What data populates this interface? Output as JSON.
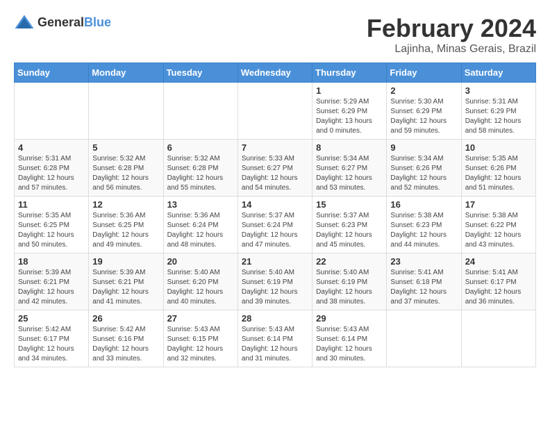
{
  "logo": {
    "general": "General",
    "blue": "Blue"
  },
  "title": {
    "month": "February 2024",
    "location": "Lajinha, Minas Gerais, Brazil"
  },
  "headers": [
    "Sunday",
    "Monday",
    "Tuesday",
    "Wednesday",
    "Thursday",
    "Friday",
    "Saturday"
  ],
  "weeks": [
    [
      {
        "day": "",
        "info": ""
      },
      {
        "day": "",
        "info": ""
      },
      {
        "day": "",
        "info": ""
      },
      {
        "day": "",
        "info": ""
      },
      {
        "day": "1",
        "sunrise": "Sunrise: 5:29 AM",
        "sunset": "Sunset: 6:29 PM",
        "daylight": "Daylight: 13 hours and 0 minutes."
      },
      {
        "day": "2",
        "sunrise": "Sunrise: 5:30 AM",
        "sunset": "Sunset: 6:29 PM",
        "daylight": "Daylight: 12 hours and 59 minutes."
      },
      {
        "day": "3",
        "sunrise": "Sunrise: 5:31 AM",
        "sunset": "Sunset: 6:29 PM",
        "daylight": "Daylight: 12 hours and 58 minutes."
      }
    ],
    [
      {
        "day": "4",
        "sunrise": "Sunrise: 5:31 AM",
        "sunset": "Sunset: 6:28 PM",
        "daylight": "Daylight: 12 hours and 57 minutes."
      },
      {
        "day": "5",
        "sunrise": "Sunrise: 5:32 AM",
        "sunset": "Sunset: 6:28 PM",
        "daylight": "Daylight: 12 hours and 56 minutes."
      },
      {
        "day": "6",
        "sunrise": "Sunrise: 5:32 AM",
        "sunset": "Sunset: 6:28 PM",
        "daylight": "Daylight: 12 hours and 55 minutes."
      },
      {
        "day": "7",
        "sunrise": "Sunrise: 5:33 AM",
        "sunset": "Sunset: 6:27 PM",
        "daylight": "Daylight: 12 hours and 54 minutes."
      },
      {
        "day": "8",
        "sunrise": "Sunrise: 5:34 AM",
        "sunset": "Sunset: 6:27 PM",
        "daylight": "Daylight: 12 hours and 53 minutes."
      },
      {
        "day": "9",
        "sunrise": "Sunrise: 5:34 AM",
        "sunset": "Sunset: 6:26 PM",
        "daylight": "Daylight: 12 hours and 52 minutes."
      },
      {
        "day": "10",
        "sunrise": "Sunrise: 5:35 AM",
        "sunset": "Sunset: 6:26 PM",
        "daylight": "Daylight: 12 hours and 51 minutes."
      }
    ],
    [
      {
        "day": "11",
        "sunrise": "Sunrise: 5:35 AM",
        "sunset": "Sunset: 6:25 PM",
        "daylight": "Daylight: 12 hours and 50 minutes."
      },
      {
        "day": "12",
        "sunrise": "Sunrise: 5:36 AM",
        "sunset": "Sunset: 6:25 PM",
        "daylight": "Daylight: 12 hours and 49 minutes."
      },
      {
        "day": "13",
        "sunrise": "Sunrise: 5:36 AM",
        "sunset": "Sunset: 6:24 PM",
        "daylight": "Daylight: 12 hours and 48 minutes."
      },
      {
        "day": "14",
        "sunrise": "Sunrise: 5:37 AM",
        "sunset": "Sunset: 6:24 PM",
        "daylight": "Daylight: 12 hours and 47 minutes."
      },
      {
        "day": "15",
        "sunrise": "Sunrise: 5:37 AM",
        "sunset": "Sunset: 6:23 PM",
        "daylight": "Daylight: 12 hours and 45 minutes."
      },
      {
        "day": "16",
        "sunrise": "Sunrise: 5:38 AM",
        "sunset": "Sunset: 6:23 PM",
        "daylight": "Daylight: 12 hours and 44 minutes."
      },
      {
        "day": "17",
        "sunrise": "Sunrise: 5:38 AM",
        "sunset": "Sunset: 6:22 PM",
        "daylight": "Daylight: 12 hours and 43 minutes."
      }
    ],
    [
      {
        "day": "18",
        "sunrise": "Sunrise: 5:39 AM",
        "sunset": "Sunset: 6:21 PM",
        "daylight": "Daylight: 12 hours and 42 minutes."
      },
      {
        "day": "19",
        "sunrise": "Sunrise: 5:39 AM",
        "sunset": "Sunset: 6:21 PM",
        "daylight": "Daylight: 12 hours and 41 minutes."
      },
      {
        "day": "20",
        "sunrise": "Sunrise: 5:40 AM",
        "sunset": "Sunset: 6:20 PM",
        "daylight": "Daylight: 12 hours and 40 minutes."
      },
      {
        "day": "21",
        "sunrise": "Sunrise: 5:40 AM",
        "sunset": "Sunset: 6:19 PM",
        "daylight": "Daylight: 12 hours and 39 minutes."
      },
      {
        "day": "22",
        "sunrise": "Sunrise: 5:40 AM",
        "sunset": "Sunset: 6:19 PM",
        "daylight": "Daylight: 12 hours and 38 minutes."
      },
      {
        "day": "23",
        "sunrise": "Sunrise: 5:41 AM",
        "sunset": "Sunset: 6:18 PM",
        "daylight": "Daylight: 12 hours and 37 minutes."
      },
      {
        "day": "24",
        "sunrise": "Sunrise: 5:41 AM",
        "sunset": "Sunset: 6:17 PM",
        "daylight": "Daylight: 12 hours and 36 minutes."
      }
    ],
    [
      {
        "day": "25",
        "sunrise": "Sunrise: 5:42 AM",
        "sunset": "Sunset: 6:17 PM",
        "daylight": "Daylight: 12 hours and 34 minutes."
      },
      {
        "day": "26",
        "sunrise": "Sunrise: 5:42 AM",
        "sunset": "Sunset: 6:16 PM",
        "daylight": "Daylight: 12 hours and 33 minutes."
      },
      {
        "day": "27",
        "sunrise": "Sunrise: 5:43 AM",
        "sunset": "Sunset: 6:15 PM",
        "daylight": "Daylight: 12 hours and 32 minutes."
      },
      {
        "day": "28",
        "sunrise": "Sunrise: 5:43 AM",
        "sunset": "Sunset: 6:14 PM",
        "daylight": "Daylight: 12 hours and 31 minutes."
      },
      {
        "day": "29",
        "sunrise": "Sunrise: 5:43 AM",
        "sunset": "Sunset: 6:14 PM",
        "daylight": "Daylight: 12 hours and 30 minutes."
      },
      {
        "day": "",
        "info": ""
      },
      {
        "day": "",
        "info": ""
      }
    ]
  ]
}
